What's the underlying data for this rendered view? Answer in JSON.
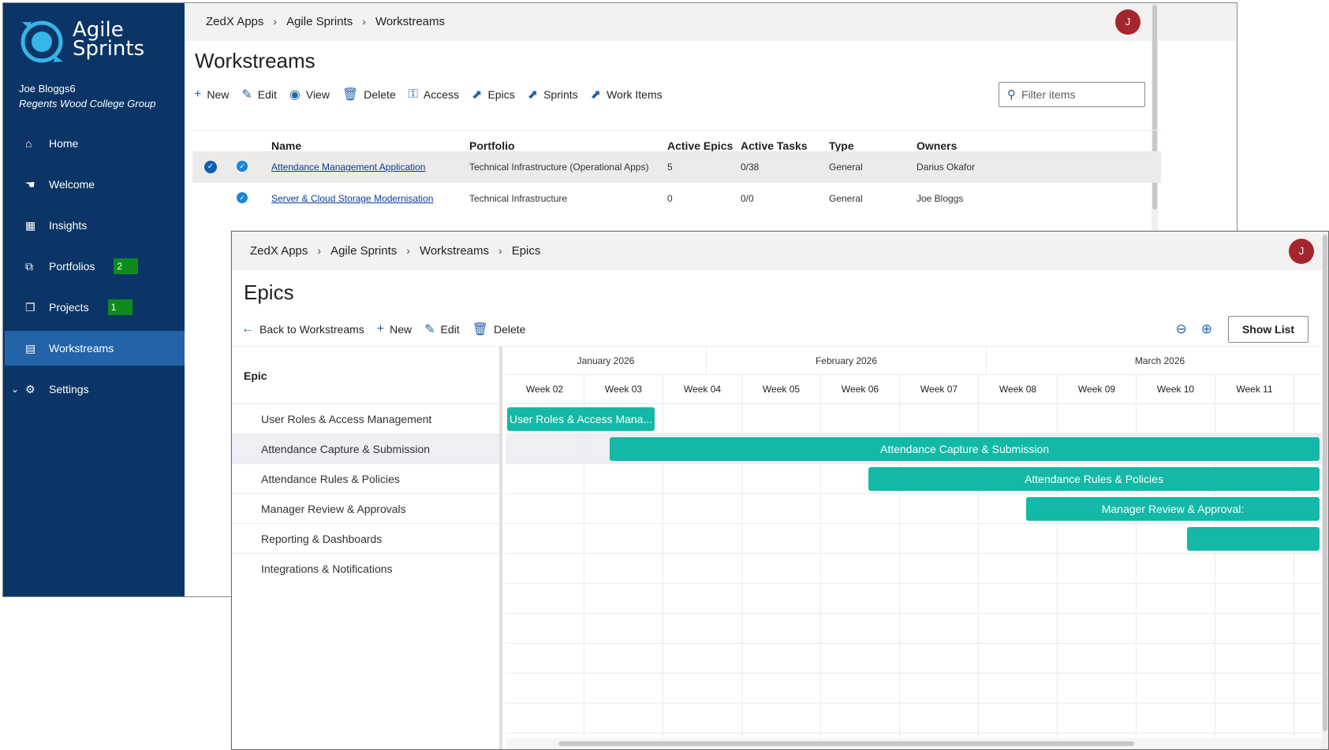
{
  "back": {
    "app_name_line1": "Agile",
    "app_name_line2": "Sprints",
    "user_name": "Joe Bloggs6",
    "org_name": "Regents Wood College Group",
    "nav": [
      {
        "label": "Home",
        "icon": "home-icon",
        "glyph": "⌂"
      },
      {
        "label": "Welcome",
        "icon": "wave-icon",
        "glyph": "☚"
      },
      {
        "label": "Insights",
        "icon": "dashboard-icon",
        "glyph": "▦"
      },
      {
        "label": "Portfolios",
        "icon": "portfolio-icon",
        "glyph": "⧉",
        "badge": "2"
      },
      {
        "label": "Projects",
        "icon": "project-icon",
        "glyph": "❐",
        "badge": "1"
      },
      {
        "label": "Workstreams",
        "icon": "workstream-icon",
        "glyph": "▤",
        "active": true
      },
      {
        "label": "Settings",
        "icon": "gear-icon",
        "glyph": "⚙"
      }
    ],
    "breadcrumbs": [
      "ZedX Apps",
      "Agile Sprints",
      "Workstreams"
    ],
    "avatar_initial": "J",
    "page_title": "Workstreams",
    "commands": [
      {
        "label": "New",
        "icon": "plus-icon",
        "glyph": "+"
      },
      {
        "label": "Edit",
        "icon": "pencil-icon",
        "glyph": "✎"
      },
      {
        "label": "View",
        "icon": "eye-icon",
        "glyph": "◉"
      },
      {
        "label": "Delete",
        "icon": "trash-icon",
        "glyph": "🗑"
      },
      {
        "label": "Access",
        "icon": "access-icon",
        "glyph": "⚿"
      },
      {
        "label": "Epics",
        "icon": "epics-icon",
        "glyph": "⬈"
      },
      {
        "label": "Sprints",
        "icon": "sprints-icon",
        "glyph": "⬈"
      },
      {
        "label": "Work Items",
        "icon": "work-items-icon",
        "glyph": "⬈"
      }
    ],
    "filter_placeholder": "Filter items",
    "columns": [
      "Name",
      "Portfolio",
      "Active Epics",
      "Active Tasks",
      "Type",
      "Owners"
    ],
    "rows": [
      {
        "name": "Attendance Management Application",
        "portfolio": "Technical Infrastructure (Operational Apps)",
        "active_epics": "5",
        "active_tasks": "0/38",
        "type": "General",
        "owners": "Darius Okafor",
        "selected": true
      },
      {
        "name": "Server & Cloud Storage Modernisation",
        "portfolio": "Technical Infrastructure",
        "active_epics": "0",
        "active_tasks": "0/0",
        "type": "General",
        "owners": "Joe Bloggs",
        "selected": false
      }
    ]
  },
  "front": {
    "breadcrumbs": [
      "ZedX Apps",
      "Agile Sprints",
      "Workstreams",
      "Epics"
    ],
    "avatar_initial": "J",
    "page_title": "Epics",
    "commands": [
      {
        "label": "Back to Workstreams",
        "icon": "arrow-left-icon",
        "glyph": "←"
      },
      {
        "label": "New",
        "icon": "plus-icon",
        "glyph": "+"
      },
      {
        "label": "Edit",
        "icon": "pencil-icon",
        "glyph": "✎"
      },
      {
        "label": "Delete",
        "icon": "trash-icon",
        "glyph": "🗑"
      }
    ],
    "zoom_out_glyph": "⊖",
    "zoom_in_glyph": "⊕",
    "show_list_label": "Show List",
    "epic_header": "Epic",
    "epics": [
      "User Roles & Access Management",
      "Attendance Capture & Submission",
      "Attendance Rules & Policies",
      "Manager Review & Approvals",
      "Reporting & Dashboards",
      "Integrations & Notifications"
    ],
    "months": [
      {
        "label": "January 2026",
        "weeks": 2.55
      },
      {
        "label": "February 2026",
        "weeks": 3.55
      },
      {
        "label": "March 2026",
        "weeks": 4.4
      }
    ],
    "weeks": [
      "Week 02",
      "Week 03",
      "Week 04",
      "Week 05",
      "Week 06",
      "Week 07",
      "Week 08",
      "Week 09",
      "Week 10",
      "Week 11"
    ],
    "bars": [
      {
        "row": 0,
        "start_week": 0.0,
        "end_week": 1.87,
        "label": "User Roles & Access Mana..."
      },
      {
        "row": 1,
        "start_week": 1.3,
        "end_week": 10.3,
        "label": "Attendance Capture & Submission"
      },
      {
        "row": 2,
        "start_week": 4.58,
        "end_week": 10.3,
        "label": "Attendance Rules & Policies"
      },
      {
        "row": 3,
        "start_week": 6.58,
        "end_week": 10.3,
        "label": "Manager Review & Approval:"
      },
      {
        "row": 4,
        "start_week": 8.62,
        "end_week": 10.3,
        "label": ""
      }
    ],
    "highlight_row": 1,
    "bar_color": "#14b8a6"
  }
}
